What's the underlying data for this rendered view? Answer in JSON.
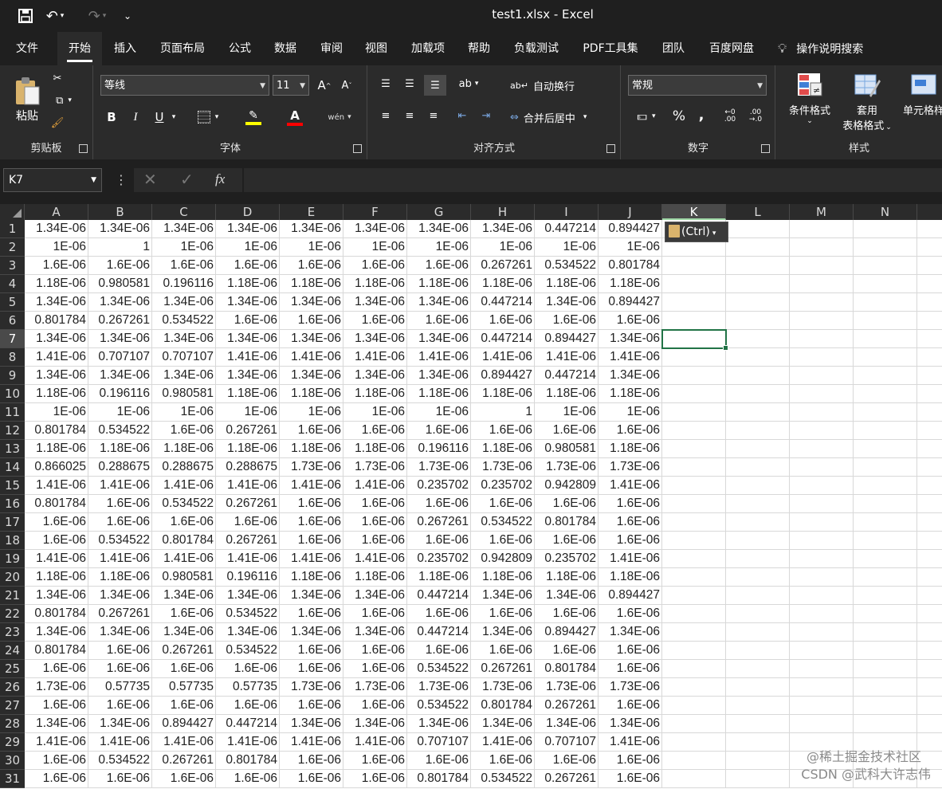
{
  "window": {
    "title": "test1.xlsx - Excel"
  },
  "menu": [
    "文件",
    "开始",
    "插入",
    "页面布局",
    "公式",
    "数据",
    "审阅",
    "视图",
    "加载项",
    "帮助",
    "负载测试",
    "PDF工具集",
    "团队",
    "百度网盘"
  ],
  "menu_active": "开始",
  "tell_me": "操作说明搜索",
  "ribbon": {
    "clipboard": {
      "paste": "粘贴",
      "label": "剪贴板"
    },
    "font": {
      "name": "等线",
      "size": "11",
      "bold": "B",
      "italic": "I",
      "underline": "U",
      "label": "字体"
    },
    "alignment": {
      "wrap": "自动换行",
      "merge": "合并后居中",
      "label": "对齐方式"
    },
    "number": {
      "format": "常规",
      "percent": "%",
      "comma": ",",
      "label": "数字"
    },
    "styles": {
      "conditional": "条件格式",
      "table1": "套用",
      "table2": "表格格式",
      "cell_style": "单元格样",
      "label": "样式"
    }
  },
  "name_box": "K7",
  "formula_fx": "fx",
  "columns": [
    "A",
    "B",
    "C",
    "D",
    "E",
    "F",
    "G",
    "H",
    "I",
    "J",
    "K",
    "L",
    "M",
    "N"
  ],
  "selected_column": "K",
  "selected_row": 7,
  "paste_options": "(Ctrl)",
  "rows": [
    [
      "1.34E-06",
      "1.34E-06",
      "1.34E-06",
      "1.34E-06",
      "1.34E-06",
      "1.34E-06",
      "1.34E-06",
      "1.34E-06",
      "0.447214",
      "0.894427"
    ],
    [
      "1E-06",
      "1",
      "1E-06",
      "1E-06",
      "1E-06",
      "1E-06",
      "1E-06",
      "1E-06",
      "1E-06",
      "1E-06"
    ],
    [
      "1.6E-06",
      "1.6E-06",
      "1.6E-06",
      "1.6E-06",
      "1.6E-06",
      "1.6E-06",
      "1.6E-06",
      "0.267261",
      "0.534522",
      "0.801784"
    ],
    [
      "1.18E-06",
      "0.980581",
      "0.196116",
      "1.18E-06",
      "1.18E-06",
      "1.18E-06",
      "1.18E-06",
      "1.18E-06",
      "1.18E-06",
      "1.18E-06"
    ],
    [
      "1.34E-06",
      "1.34E-06",
      "1.34E-06",
      "1.34E-06",
      "1.34E-06",
      "1.34E-06",
      "1.34E-06",
      "0.447214",
      "1.34E-06",
      "0.894427"
    ],
    [
      "0.801784",
      "0.267261",
      "0.534522",
      "1.6E-06",
      "1.6E-06",
      "1.6E-06",
      "1.6E-06",
      "1.6E-06",
      "1.6E-06",
      "1.6E-06"
    ],
    [
      "1.34E-06",
      "1.34E-06",
      "1.34E-06",
      "1.34E-06",
      "1.34E-06",
      "1.34E-06",
      "1.34E-06",
      "0.447214",
      "0.894427",
      "1.34E-06"
    ],
    [
      "1.41E-06",
      "0.707107",
      "0.707107",
      "1.41E-06",
      "1.41E-06",
      "1.41E-06",
      "1.41E-06",
      "1.41E-06",
      "1.41E-06",
      "1.41E-06"
    ],
    [
      "1.34E-06",
      "1.34E-06",
      "1.34E-06",
      "1.34E-06",
      "1.34E-06",
      "1.34E-06",
      "1.34E-06",
      "0.894427",
      "0.447214",
      "1.34E-06"
    ],
    [
      "1.18E-06",
      "0.196116",
      "0.980581",
      "1.18E-06",
      "1.18E-06",
      "1.18E-06",
      "1.18E-06",
      "1.18E-06",
      "1.18E-06",
      "1.18E-06"
    ],
    [
      "1E-06",
      "1E-06",
      "1E-06",
      "1E-06",
      "1E-06",
      "1E-06",
      "1E-06",
      "1",
      "1E-06",
      "1E-06"
    ],
    [
      "0.801784",
      "0.534522",
      "1.6E-06",
      "0.267261",
      "1.6E-06",
      "1.6E-06",
      "1.6E-06",
      "1.6E-06",
      "1.6E-06",
      "1.6E-06"
    ],
    [
      "1.18E-06",
      "1.18E-06",
      "1.18E-06",
      "1.18E-06",
      "1.18E-06",
      "1.18E-06",
      "0.196116",
      "1.18E-06",
      "0.980581",
      "1.18E-06"
    ],
    [
      "0.866025",
      "0.288675",
      "0.288675",
      "0.288675",
      "1.73E-06",
      "1.73E-06",
      "1.73E-06",
      "1.73E-06",
      "1.73E-06",
      "1.73E-06"
    ],
    [
      "1.41E-06",
      "1.41E-06",
      "1.41E-06",
      "1.41E-06",
      "1.41E-06",
      "1.41E-06",
      "0.235702",
      "0.235702",
      "0.942809",
      "1.41E-06"
    ],
    [
      "0.801784",
      "1.6E-06",
      "0.534522",
      "0.267261",
      "1.6E-06",
      "1.6E-06",
      "1.6E-06",
      "1.6E-06",
      "1.6E-06",
      "1.6E-06"
    ],
    [
      "1.6E-06",
      "1.6E-06",
      "1.6E-06",
      "1.6E-06",
      "1.6E-06",
      "1.6E-06",
      "0.267261",
      "0.534522",
      "0.801784",
      "1.6E-06"
    ],
    [
      "1.6E-06",
      "0.534522",
      "0.801784",
      "0.267261",
      "1.6E-06",
      "1.6E-06",
      "1.6E-06",
      "1.6E-06",
      "1.6E-06",
      "1.6E-06"
    ],
    [
      "1.41E-06",
      "1.41E-06",
      "1.41E-06",
      "1.41E-06",
      "1.41E-06",
      "1.41E-06",
      "0.235702",
      "0.942809",
      "0.235702",
      "1.41E-06"
    ],
    [
      "1.18E-06",
      "1.18E-06",
      "0.980581",
      "0.196116",
      "1.18E-06",
      "1.18E-06",
      "1.18E-06",
      "1.18E-06",
      "1.18E-06",
      "1.18E-06"
    ],
    [
      "1.34E-06",
      "1.34E-06",
      "1.34E-06",
      "1.34E-06",
      "1.34E-06",
      "1.34E-06",
      "0.447214",
      "1.34E-06",
      "1.34E-06",
      "0.894427"
    ],
    [
      "0.801784",
      "0.267261",
      "1.6E-06",
      "0.534522",
      "1.6E-06",
      "1.6E-06",
      "1.6E-06",
      "1.6E-06",
      "1.6E-06",
      "1.6E-06"
    ],
    [
      "1.34E-06",
      "1.34E-06",
      "1.34E-06",
      "1.34E-06",
      "1.34E-06",
      "1.34E-06",
      "0.447214",
      "1.34E-06",
      "0.894427",
      "1.34E-06"
    ],
    [
      "0.801784",
      "1.6E-06",
      "0.267261",
      "0.534522",
      "1.6E-06",
      "1.6E-06",
      "1.6E-06",
      "1.6E-06",
      "1.6E-06",
      "1.6E-06"
    ],
    [
      "1.6E-06",
      "1.6E-06",
      "1.6E-06",
      "1.6E-06",
      "1.6E-06",
      "1.6E-06",
      "0.534522",
      "0.267261",
      "0.801784",
      "1.6E-06"
    ],
    [
      "1.73E-06",
      "0.57735",
      "0.57735",
      "0.57735",
      "1.73E-06",
      "1.73E-06",
      "1.73E-06",
      "1.73E-06",
      "1.73E-06",
      "1.73E-06"
    ],
    [
      "1.6E-06",
      "1.6E-06",
      "1.6E-06",
      "1.6E-06",
      "1.6E-06",
      "1.6E-06",
      "0.534522",
      "0.801784",
      "0.267261",
      "1.6E-06"
    ],
    [
      "1.34E-06",
      "1.34E-06",
      "0.894427",
      "0.447214",
      "1.34E-06",
      "1.34E-06",
      "1.34E-06",
      "1.34E-06",
      "1.34E-06",
      "1.34E-06"
    ],
    [
      "1.41E-06",
      "1.41E-06",
      "1.41E-06",
      "1.41E-06",
      "1.41E-06",
      "1.41E-06",
      "0.707107",
      "1.41E-06",
      "0.707107",
      "1.41E-06"
    ],
    [
      "1.6E-06",
      "0.534522",
      "0.267261",
      "0.801784",
      "1.6E-06",
      "1.6E-06",
      "1.6E-06",
      "1.6E-06",
      "1.6E-06",
      "1.6E-06"
    ],
    [
      "1.6E-06",
      "1.6E-06",
      "1.6E-06",
      "1.6E-06",
      "1.6E-06",
      "1.6E-06",
      "0.801784",
      "0.534522",
      "0.267261",
      "1.6E-06"
    ]
  ],
  "watermark": {
    "line1": "@稀土掘金技术社区",
    "line2": "CSDN @武科大许志伟"
  }
}
